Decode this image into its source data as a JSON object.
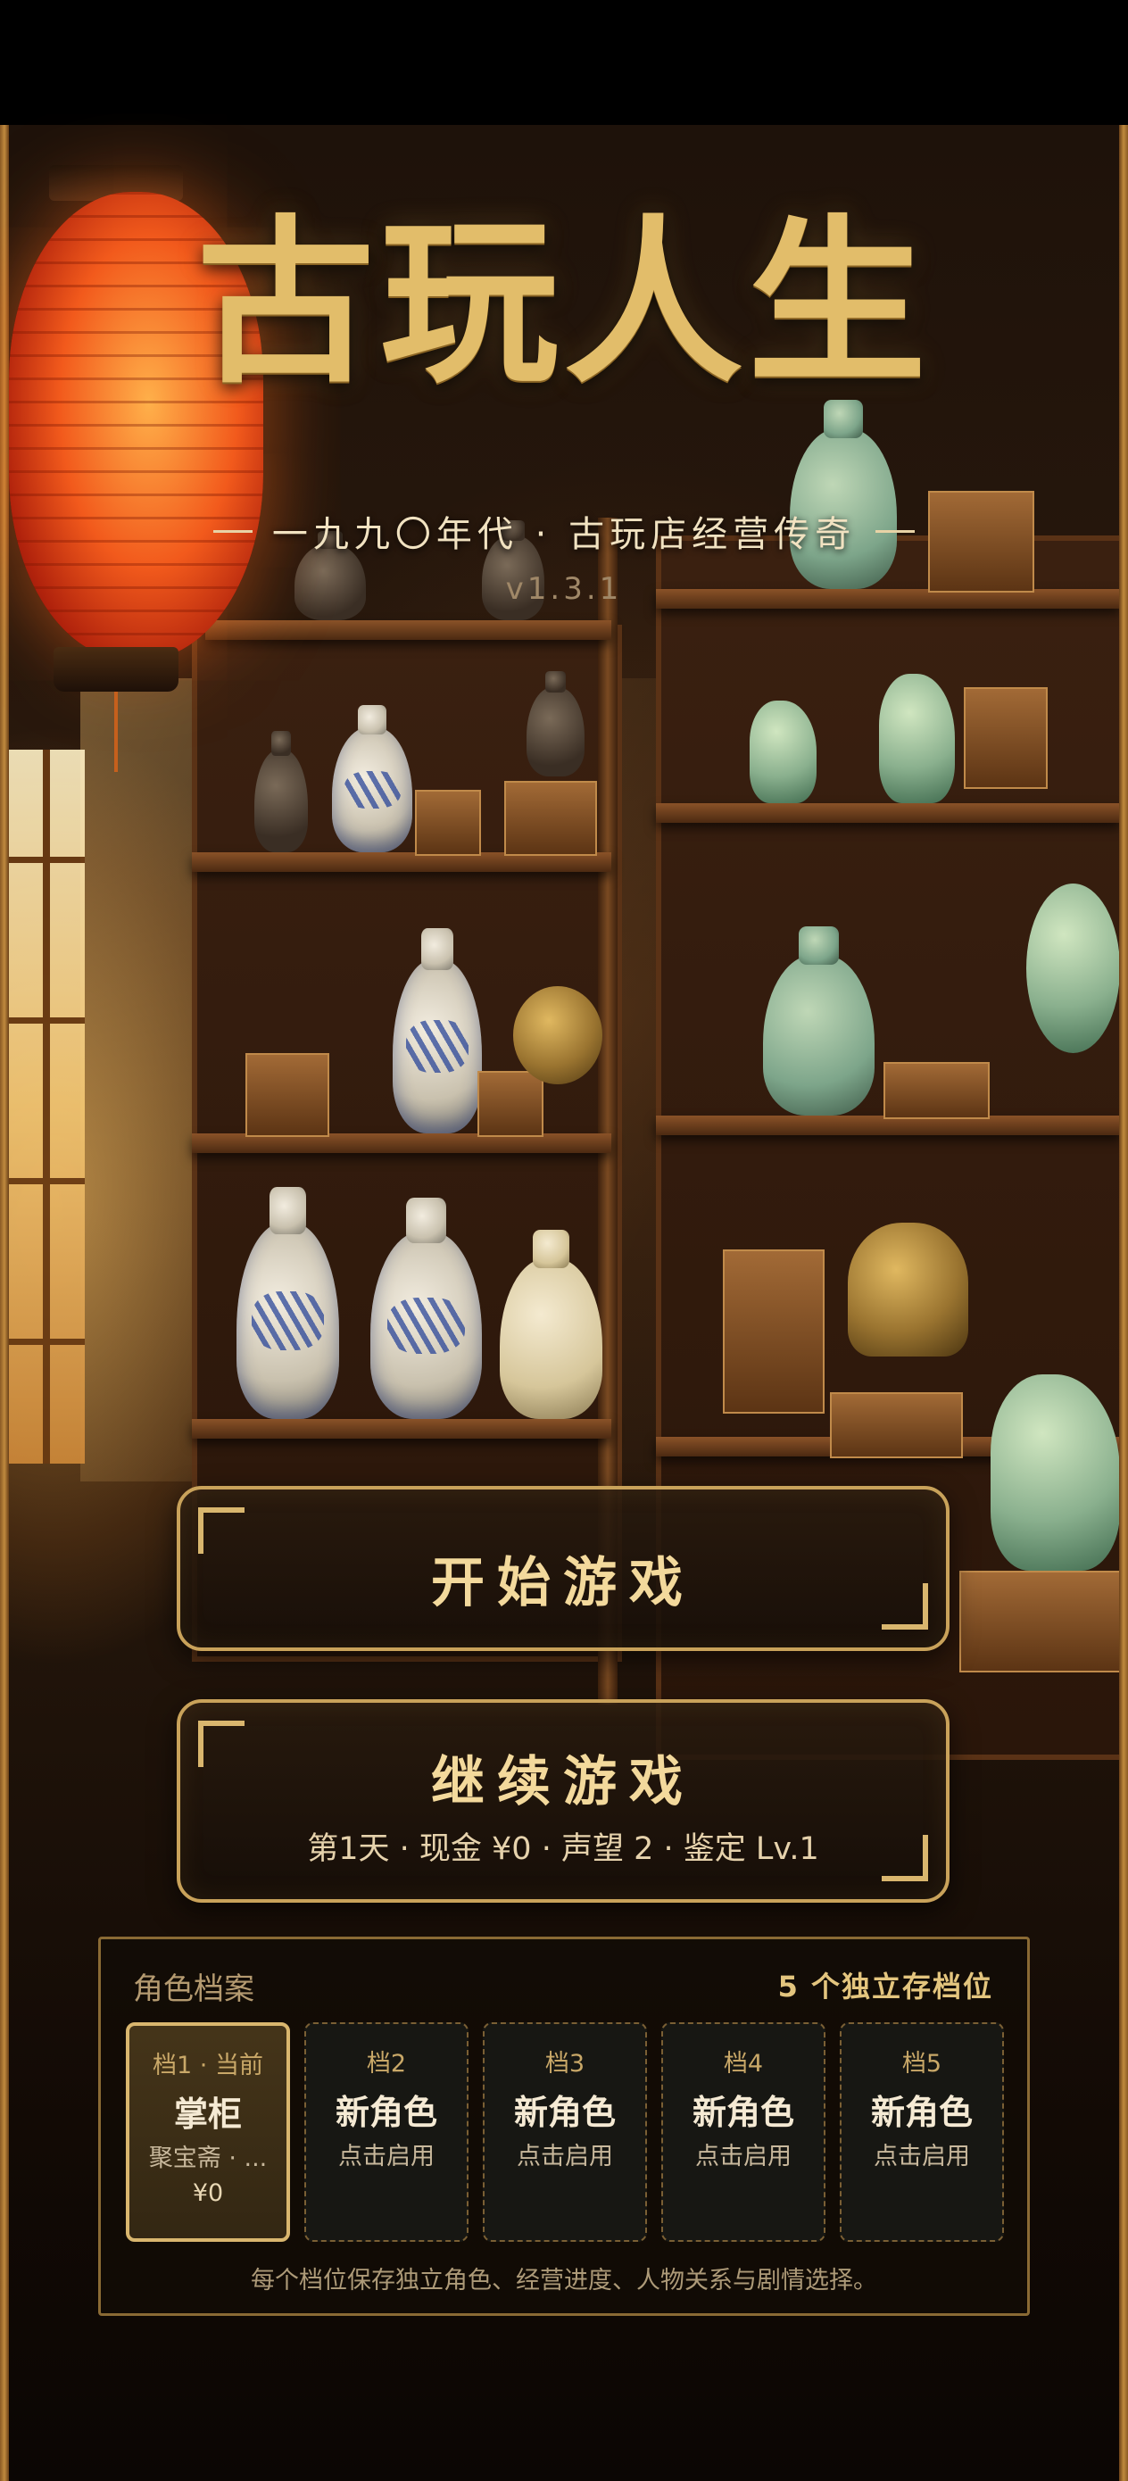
{
  "title": "古玩人生",
  "subtitle": "一九九〇年代 · 古玩店经营传奇",
  "version": "v1.3.1",
  "menu": {
    "start_label": "开始游戏",
    "continue_label": "继续游戏",
    "continue_summary": "第1天 · 现金 ¥0 · 声望 2 · 鉴定 Lv.1"
  },
  "profiles": {
    "title": "角色档案",
    "count_label": "5 个独立存档位",
    "slots": [
      {
        "label": "档1 · 当前",
        "name": "掌柜",
        "detail": "聚宝斋 · ...",
        "cash": "¥0",
        "active": true
      },
      {
        "label": "档2",
        "name": "新角色",
        "detail": "点击启用",
        "active": false
      },
      {
        "label": "档3",
        "name": "新角色",
        "detail": "点击启用",
        "active": false
      },
      {
        "label": "档4",
        "name": "新角色",
        "detail": "点击启用",
        "active": false
      },
      {
        "label": "档5",
        "name": "新角色",
        "detail": "点击启用",
        "active": false
      }
    ],
    "note": "每个档位保存独立角色、经营进度、人物关系与剧情选择。"
  },
  "colors": {
    "accent_gold": "#d9b66e",
    "title_gold": "#e2bd6a",
    "lantern_red": "#f25a1c"
  }
}
